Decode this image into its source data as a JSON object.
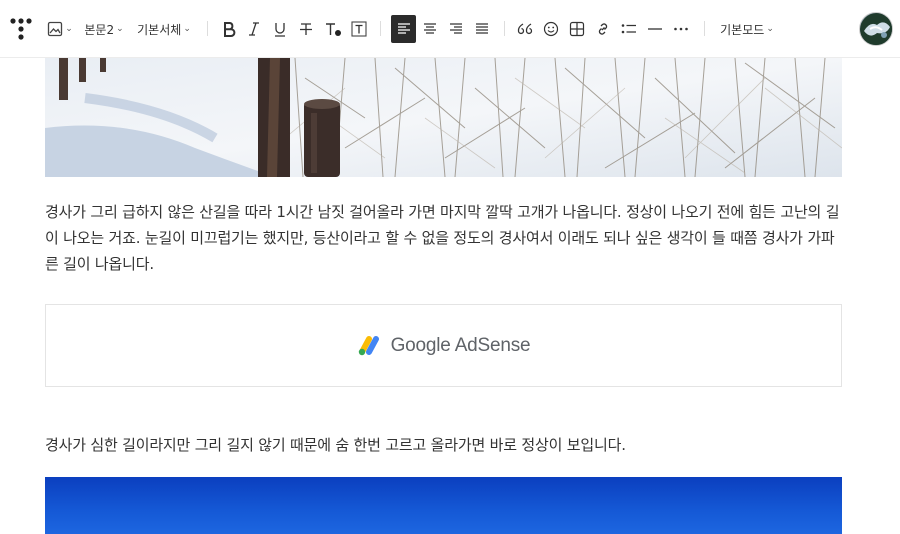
{
  "toolbar": {
    "style_select": "본문2",
    "font_select": "기본서체",
    "mode_select": "기본모드"
  },
  "content": {
    "paragraph_1": "경사가 그리 급하지 않은 산길을 따라 1시간 남짓 걸어올라 가면 마지막 깔딱 고개가 나옵니다. 정상이 나오기 전에 힘든 고난의 길이 나오는 거죠. 눈길이 미끄럽기는 했지만, 등산이라고 할 수 없을 정도의 경사여서 이래도 되나 싶은 생각이 들 때쯤 경사가 가파른 길이 나옵니다.",
    "ad_label": "Google AdSense",
    "paragraph_2": "경사가 심한 길이라지만 그리 길지 않기 때문에 숨 한번 고르고 올라가면 바로 정상이 보입니다."
  },
  "colors": {
    "active_align_bg": "#2b2b2b",
    "sky_blue": "#1559d6",
    "adsense_yellow": "#fbbc04",
    "adsense_blue": "#4285f4",
    "adsense_green": "#34a853"
  }
}
